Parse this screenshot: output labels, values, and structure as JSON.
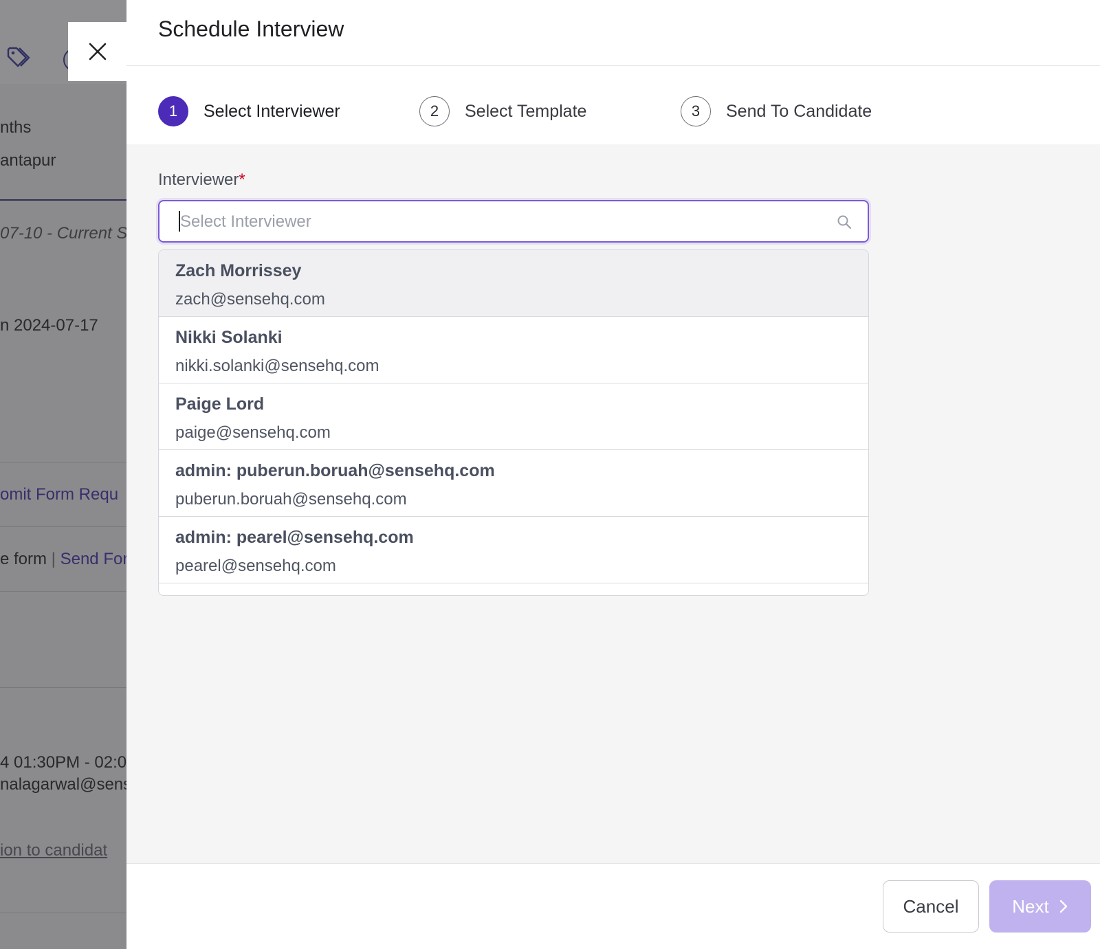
{
  "background": {
    "lines": [
      "nths",
      "antapur",
      "07-10 - Current S",
      "n 2024-07-17",
      "omit Form Requ",
      "e form",
      "Send For",
      "4 01:30PM - 02:0",
      "nalagarwal@sens",
      "ion to candidat"
    ]
  },
  "panel": {
    "title": "Schedule Interview",
    "steps": [
      {
        "num": "1",
        "label": "Select Interviewer",
        "active": true
      },
      {
        "num": "2",
        "label": "Select Template",
        "active": false
      },
      {
        "num": "3",
        "label": "Send To Candidate",
        "active": false
      }
    ],
    "field": {
      "label": "Interviewer",
      "required_mark": "*",
      "placeholder": "Select Interviewer"
    },
    "options": [
      {
        "name": "Zach Morrissey",
        "email": "zach@sensehq.com"
      },
      {
        "name": "Nikki Solanki",
        "email": "nikki.solanki@sensehq.com"
      },
      {
        "name": "Paige Lord",
        "email": "paige@sensehq.com"
      },
      {
        "name": "admin: puberun.boruah@sensehq.com",
        "email": "puberun.boruah@sensehq.com"
      },
      {
        "name": "admin: pearel@sensehq.com",
        "email": "pearel@sensehq.com"
      }
    ],
    "footer": {
      "cancel_label": "Cancel",
      "next_label": "Next"
    }
  },
  "icons": {
    "close": "close-icon",
    "search": "search-icon",
    "next": "chevron-right-icon",
    "tag": "tag-icon"
  },
  "colors": {
    "accent": "#4b2bb8",
    "next_disabled": "#c0b2ee"
  }
}
